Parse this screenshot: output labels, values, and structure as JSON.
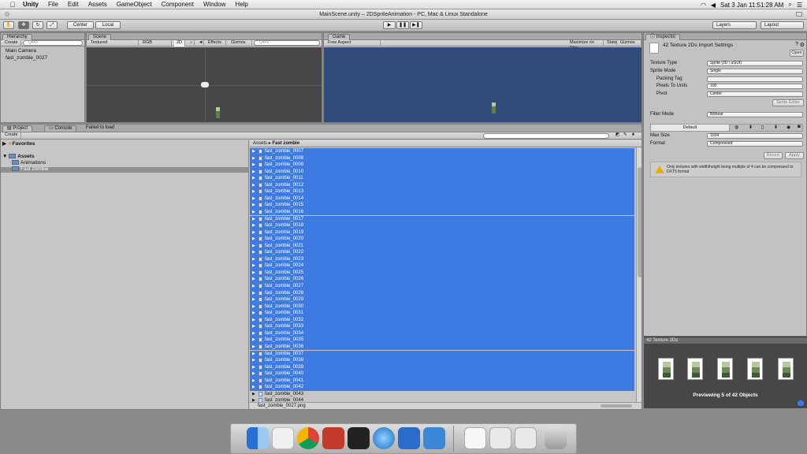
{
  "menubar": {
    "app": "Unity",
    "items": [
      "File",
      "Edit",
      "Assets",
      "GameObject",
      "Component",
      "Window",
      "Help"
    ],
    "clock": "Sat 3 Jan  11:51:28 AM"
  },
  "window": {
    "title": "MainScene.unity – 2DSpriteAnimation - PC, Mac & Linux Standalone"
  },
  "toolbar": {
    "pivot": "Center",
    "space": "Local",
    "layers": "Layers",
    "layout": "Layout"
  },
  "hierarchy": {
    "tab": "Hierarchy",
    "create": "Create",
    "search_placeholder": "Q▾All",
    "items": [
      "Main Camera",
      "fast_zombie_0027"
    ]
  },
  "scene": {
    "tab": "Scene",
    "shading": "Textured",
    "render": "RGB",
    "mode2d": "2D",
    "effects": "Effects",
    "gizmos": "Gizmos",
    "search_placeholder": "Q▾All"
  },
  "game": {
    "tab": "Game",
    "aspect": "Free Aspect",
    "maximize": "Maximize on Play",
    "stats": "Stats",
    "gizmos": "Gizmos"
  },
  "project": {
    "tab": "Project",
    "console_tab": "Console",
    "status": "Failed to load",
    "create": "Create",
    "tree": {
      "favorites": "Favorites",
      "assets": "Assets",
      "animations": "Animations",
      "fast_zombie": "Fast zombie"
    },
    "breadcrumb_root": "Assets",
    "breadcrumb_current": "Fast zombie",
    "files": [
      "fast_zombie_0007",
      "fast_zombie_0008",
      "fast_zombie_0009",
      "fast_zombie_0010",
      "fast_zombie_0011",
      "fast_zombie_0012",
      "fast_zombie_0013",
      "fast_zombie_0014",
      "fast_zombie_0015",
      "fast_zombie_0016",
      "fast_zombie_0017",
      "fast_zombie_0018",
      "fast_zombie_0019",
      "fast_zombie_0020",
      "fast_zombie_0021",
      "fast_zombie_0022",
      "fast_zombie_0023",
      "fast_zombie_0024",
      "fast_zombie_0025",
      "fast_zombie_0026",
      "fast_zombie_0027",
      "fast_zombie_0028",
      "fast_zombie_0029",
      "fast_zombie_0030",
      "fast_zombie_0031",
      "fast_zombie_0032",
      "fast_zombie_0033",
      "fast_zombie_0034",
      "fast_zombie_0035",
      "fast_zombie_0036",
      "fast_zombie_0037",
      "fast_zombie_0038",
      "fast_zombie_0039",
      "fast_zombie_0040",
      "fast_zombie_0041",
      "fast_zombie_0042",
      "fast_zombie_0043",
      "fast_zombie_0044"
    ],
    "selected_count": 36,
    "footer_file": "fast_zombie_0027.png"
  },
  "inspector": {
    "tab": "Inspector",
    "title": "42 Texture 2Ds Import Settings",
    "open": "Open",
    "fields": [
      {
        "label": "Texture Type",
        "value": "Sprite (2D \\ uGUI)"
      },
      {
        "label": "Sprite Mode",
        "value": "Single"
      },
      {
        "label": "Packing Tag",
        "value": ""
      },
      {
        "label": "Pixels To Units",
        "value": "100"
      },
      {
        "label": "Pivot",
        "value": "Center"
      }
    ],
    "sprite_editor": "Sprite Editor",
    "filter_label": "Filter Mode",
    "filter_value": "Bilinear",
    "platform_default": "Default",
    "max_size_label": "Max Size",
    "max_size_value": "1024",
    "format_label": "Format",
    "format_value": "Compressed",
    "revert": "Revert",
    "apply": "Apply",
    "warning": "Only textures with width/height being multiple of 4 can be compressed to DXT5 format"
  },
  "preview": {
    "header": "42 Texture 2Ds",
    "text": "Previewing 5 of 42 Objects",
    "count": 5
  }
}
